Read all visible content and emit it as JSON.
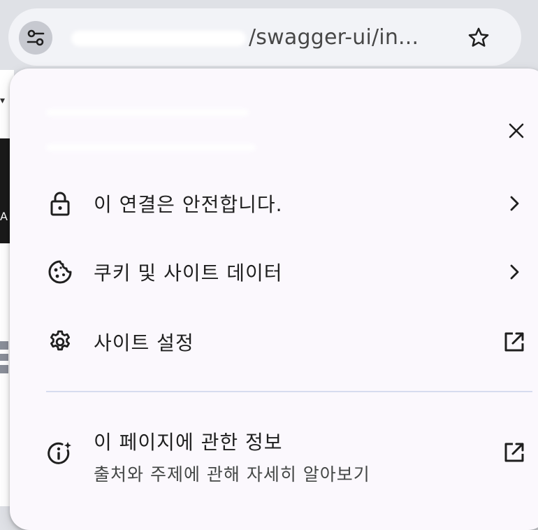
{
  "address_bar": {
    "url_suffix": "/swagger-ui/in..."
  },
  "popup": {
    "items": [
      {
        "label": "이 연결은 안전합니다.",
        "icon": "lock-icon",
        "trailing": "chevron-right-icon"
      },
      {
        "label": "쿠키 및 사이트 데이터",
        "icon": "cookie-icon",
        "trailing": "chevron-right-icon"
      },
      {
        "label": "사이트 설정",
        "icon": "gear-icon",
        "trailing": "open-in-new-icon"
      }
    ],
    "about": {
      "label": "이 페이지에 관한 정보",
      "sublabel": "출처와 주제에 관해 자세히 알아보기",
      "icon": "page-info-icon",
      "trailing": "open-in-new-icon"
    }
  },
  "background_page": {
    "dark_panel_letter": "A"
  },
  "colors": {
    "chrome_bg": "#dfe1e6",
    "omnibox_bg": "#f2f3f7",
    "popup_bg": "#fbf8fd",
    "divider": "#d6dcef",
    "text": "#1f1f1f"
  }
}
